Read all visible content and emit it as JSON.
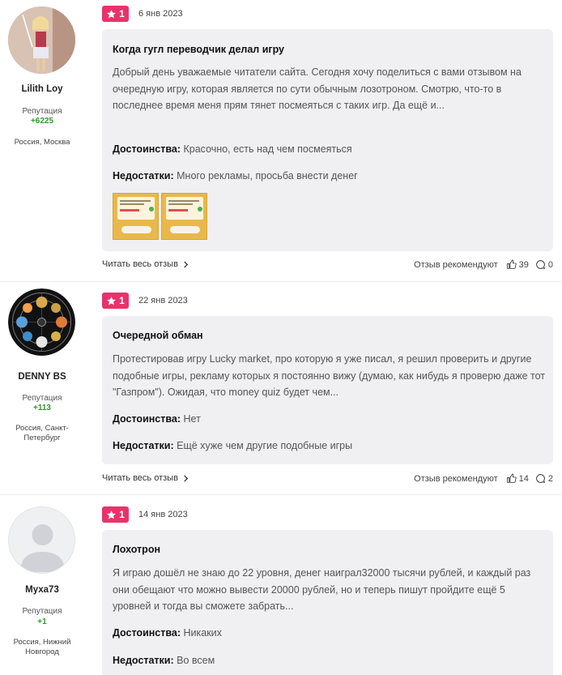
{
  "reviews": [
    {
      "author": "Lilith Loy",
      "rep_label": "Репутация",
      "rep_value": "+6225",
      "location": "Россия, Москва",
      "rating": "1",
      "date": "6 янв 2023",
      "title": "Когда гугл переводчик делал игру",
      "text": "Добрый день уважаемые читатели сайта. Сегодня хочу поделиться с вами отзывом на очередную игру, которая является по сути обычным лозотроном. Смотрю, что-то в последнее время меня прям тянет посмеяться с таких игр. Да ещё и...",
      "pros_label": "Достоинства:",
      "pros": "Красочно, есть над чем посмеяться",
      "cons_label": "Недостатки:",
      "cons": "Много рекламы, просьба внести денег",
      "read_more": "Читать весь отзыв",
      "recommend": "Отзыв рекомендуют",
      "likes": "39",
      "comments": "0"
    },
    {
      "author": "DENNY BS",
      "rep_label": "Репутация",
      "rep_value": "+113",
      "location": "Россия, Санкт-Петербург",
      "rating": "1",
      "date": "22 янв 2023",
      "title": "Очередной обман",
      "text": "Протестировав игру Lucky market, про которую я уже писал, я решил проверить и другие подобные игры, рекламу которых я постоянно вижу (думаю, как нибудь я проверю даже тот \"Газпром\"). Ожидая, что money quiz будет чем...",
      "pros_label": "Достоинства:",
      "pros": "Нет",
      "cons_label": "Недостатки:",
      "cons": "Ещё хуже чем другие подобные игры",
      "read_more": "Читать весь отзыв",
      "recommend": "Отзыв рекомендуют",
      "likes": "14",
      "comments": "2"
    },
    {
      "author": "Муха73",
      "rep_label": "Репутация",
      "rep_value": "+1",
      "location": "Россия, Нижний Новгород",
      "rating": "1",
      "date": "14 янв 2023",
      "title": "Лохотрон",
      "text": "Я играю дошёл не знаю до 22 уровня, денег наиграл32000 тысячи рублей, и каждый раз они обещают что можно вывести 20000 рублей, но и теперь пишут пройдите ещё 5 уровней и тогда вы сможете забрать...",
      "pros_label": "Достоинства:",
      "pros": "Никаких",
      "cons_label": "Недостатки:",
      "cons": "Во всем"
    }
  ],
  "colors": {
    "accent": "#e8336a",
    "reputation": "#2e9a2e",
    "card_bg": "#f0f0f3"
  },
  "icons": [
    "star-icon",
    "chevron-right-icon",
    "thumbs-up-icon",
    "comment-icon"
  ]
}
